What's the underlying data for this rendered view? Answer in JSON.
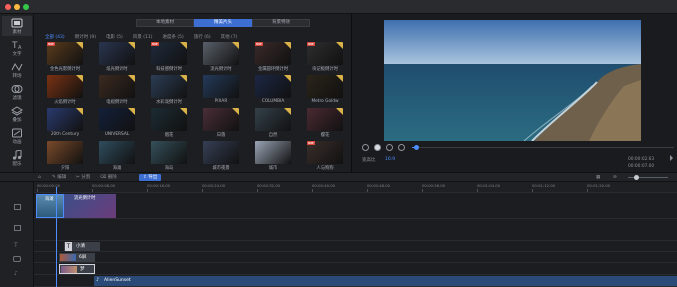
{
  "window": {
    "dots": [
      "#fc605c",
      "#fdbc40",
      "#34c84a"
    ]
  },
  "sidebar": {
    "items": [
      {
        "label": "素材",
        "icon": "media-icon",
        "active": true
      },
      {
        "label": "文字",
        "icon": "text-icon"
      },
      {
        "label": "转场",
        "icon": "transition-icon"
      },
      {
        "label": "滤镜",
        "icon": "filter-icon"
      },
      {
        "label": "叠加",
        "icon": "overlay-icon"
      },
      {
        "label": "动画",
        "icon": "animation-icon"
      },
      {
        "label": "配乐",
        "icon": "music-icon"
      }
    ]
  },
  "library": {
    "tabs": [
      "本地素材",
      "精美片头",
      "背景特效"
    ],
    "active_tab": 1,
    "categories": [
      "全部 (43)",
      "倒计时 (9)",
      "电影 (5)",
      "风景 (11)",
      "进度条 (5)",
      "旅行 (6)",
      "其他 (7)"
    ],
    "active_category": 0,
    "thumbnails": [
      {
        "label": "金色光影倒计时",
        "vip": true,
        "premium": true,
        "bg": "#5a3b1c"
      },
      {
        "label": "炫光倒计时",
        "vip": false,
        "premium": true,
        "bg": "#2a3550"
      },
      {
        "label": "科技感倒计时",
        "vip": true,
        "premium": true,
        "bg": "#1f2b3c"
      },
      {
        "label": "流光倒计时",
        "vip": false,
        "premium": true,
        "bg": "#59606a"
      },
      {
        "label": "金属圆环倒计时",
        "vip": true,
        "premium": true,
        "bg": "#3b2a2a"
      },
      {
        "label": "块记板倒计时",
        "vip": true,
        "premium": true,
        "bg": "#2e2e2e"
      },
      {
        "label": "火焰倒计时",
        "vip": false,
        "premium": true,
        "bg": "#7a3212"
      },
      {
        "label": "电视倒计时",
        "vip": false,
        "premium": true,
        "bg": "#3c2a20"
      },
      {
        "label": "水彩泼倒计时",
        "vip": false,
        "premium": true,
        "bg": "#2c3d55"
      },
      {
        "label": "PIXAR",
        "vip": false,
        "premium": false,
        "bg": "#243a5a"
      },
      {
        "label": "COLUMBIA",
        "vip": false,
        "premium": true,
        "bg": "#1c2744"
      },
      {
        "label": "Metro Goldw",
        "vip": false,
        "premium": true,
        "bg": "#2b2419"
      },
      {
        "label": "20th Century",
        "vip": false,
        "premium": true,
        "bg": "#2a3a6e"
      },
      {
        "label": "UNIVERSAL",
        "vip": false,
        "premium": true,
        "bg": "#13203a"
      },
      {
        "label": "烟花",
        "vip": false,
        "premium": true,
        "bg": "#1c2c33"
      },
      {
        "label": "日落",
        "vip": false,
        "premium": true,
        "bg": "#4a2e38"
      },
      {
        "label": "自然",
        "vip": false,
        "premium": true,
        "bg": "#34414a"
      },
      {
        "label": "樱花",
        "vip": false,
        "premium": true,
        "bg": "#4a2a33"
      },
      {
        "label": "夕阳",
        "vip": false,
        "premium": false,
        "bg": "#7a4a2a"
      },
      {
        "label": "海滩",
        "vip": false,
        "premium": false,
        "bg": "#2f4d5e"
      },
      {
        "label": "海岛",
        "vip": false,
        "premium": false,
        "bg": "#35505a"
      },
      {
        "label": "城市夜景",
        "vip": false,
        "premium": false,
        "bg": "#363f55"
      },
      {
        "label": "城市",
        "vip": false,
        "premium": false,
        "bg": "#9aa5b5"
      },
      {
        "label": "人与狗狗",
        "vip": true,
        "premium": false,
        "bg": "#3a2e2a"
      }
    ]
  },
  "preview": {
    "current_time": "00:00:02.63",
    "total_time": "00:00:07.00",
    "ratio_label": "宽高比",
    "ratio_value": "16:9"
  },
  "toolbar": {
    "edit": "编辑",
    "split": "分割",
    "delete": "删除",
    "smart": "导出"
  },
  "ruler": {
    "ticks": [
      "00:00:00.00",
      "00:00:08.00",
      "00:00:16.00",
      "00:00:24.00",
      "00:00:32.00",
      "00:00:40.00",
      "00:00:48.00",
      "00:00:56.00",
      "00:01:04.00",
      "00:01:12.00",
      "00:01:20.00"
    ]
  },
  "timeline": {
    "video_clips": [
      {
        "label": "海滩"
      },
      {
        "label": "流光倒计时"
      }
    ],
    "text_clips": [
      {
        "label": "小清"
      },
      {
        "label": "6屏"
      },
      {
        "label": "梦"
      }
    ],
    "music_clip": "AlienSunset"
  },
  "colors": {
    "accent": "#3d6fd3",
    "highlight": "#4d8dff",
    "premium": "#d9b24a",
    "vip": "#d6463a"
  }
}
